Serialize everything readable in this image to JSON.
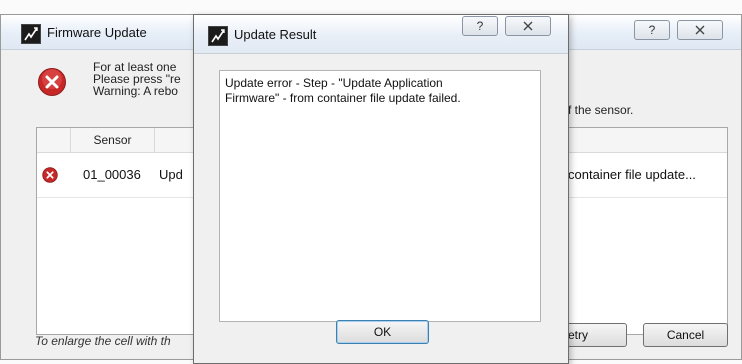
{
  "back_window": {
    "title": "Firmware Update",
    "help_glyph": "?",
    "message": {
      "line1": "For at least one",
      "line2": "Please press \"re",
      "line3": "Warning: A rebo",
      "line3_tail": "f the sensor."
    },
    "table": {
      "columns": [
        "",
        "Sensor",
        ""
      ],
      "rows": [
        {
          "status_icon": "error-icon",
          "sensor": "01_00036",
          "action": "Upd",
          "message_tail": "container file update..."
        }
      ]
    },
    "hint": "To enlarge the cell with th",
    "buttons": {
      "retry": "etry",
      "cancel": "Cancel"
    }
  },
  "dialog": {
    "title": "Update Result",
    "help_glyph": "?",
    "result_text_line1": "Update error - Step - \"Update Application",
    "result_text_line2": "Firmware\" - from container file update failed.",
    "ok_label": "OK"
  },
  "colors": {
    "error_red": "#c62828",
    "titlebar": "#e6eef8",
    "window_bg": "#f0f0f0"
  }
}
